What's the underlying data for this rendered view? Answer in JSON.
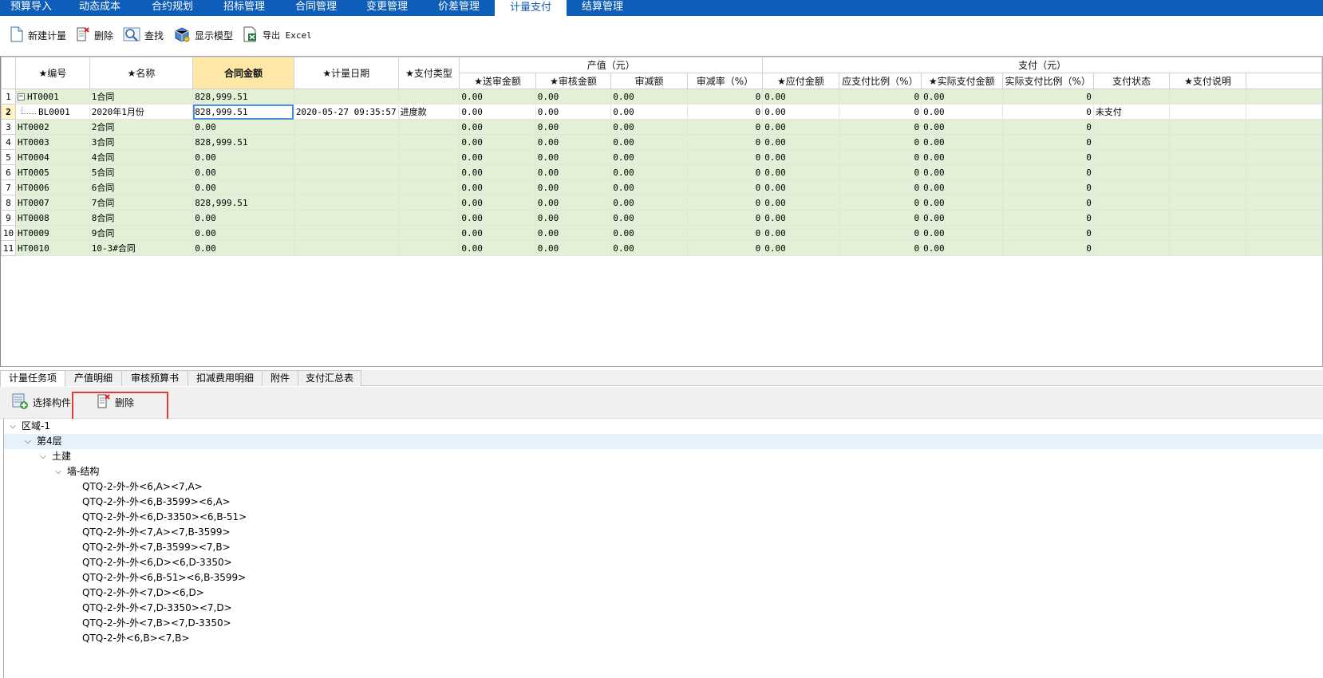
{
  "menu": {
    "items": [
      {
        "label": "预算导入",
        "width": 78
      },
      {
        "label": "动态成本",
        "width": 94
      },
      {
        "label": "合约规划",
        "width": 88
      },
      {
        "label": "招标管理",
        "width": 92
      },
      {
        "label": "合同管理",
        "width": 88
      },
      {
        "label": "变更管理",
        "width": 90
      },
      {
        "label": "价差管理",
        "width": 90
      },
      {
        "label": "计量支付",
        "width": 90,
        "active": true
      },
      {
        "label": "结算管理",
        "width": 90
      }
    ]
  },
  "toolbar": {
    "new": "新建计量",
    "delete": "删除",
    "find": "查找",
    "show_model": "显示模型",
    "export": "导出 Excel"
  },
  "grid": {
    "headers": {
      "code": "★编号",
      "name": "★名称",
      "amount": "合同金额",
      "date": "★计量日期",
      "pay_type": "★支付类型",
      "output_group": "产值（元）",
      "pay_group": "支付（元）",
      "submit_amount": "★送审金额",
      "audit_amount": "★审核金额",
      "reduce_amount": "审减额",
      "reduce_rate": "审减率（%）",
      "payable": "★应付金额",
      "payable_ratio": "应支付比例（%）",
      "actual_pay": "★实际支付金额",
      "actual_ratio": "实际支付比例（%）",
      "pay_status": "支付状态",
      "pay_note": "★支付说明"
    },
    "rows": [
      {
        "no": "1",
        "code": "HT0001",
        "name": "1合同",
        "amount": "828,999.51",
        "date": "",
        "pay_type": "",
        "c1": "0.00",
        "c2": "0.00",
        "c3": "0.00",
        "c4": "0",
        "c5": "0.00",
        "c6": "0",
        "c7": "0.00",
        "c8": "0",
        "c9": "",
        "c10": "",
        "expander": "−"
      },
      {
        "no": "2",
        "code": "BL0001",
        "name": "2020年1月份",
        "amount": "828,999.51",
        "date": "2020-05-27 09:35:57",
        "pay_type": "进度款",
        "c1": "0.00",
        "c2": "0.00",
        "c3": "0.00",
        "c4": "0",
        "c5": "0.00",
        "c6": "0",
        "c7": "0.00",
        "c8": "0",
        "c9": "未支付",
        "c10": "",
        "child": true
      },
      {
        "no": "3",
        "code": "HT0002",
        "name": "2合同",
        "amount": "0.00",
        "date": "",
        "pay_type": "",
        "c1": "0.00",
        "c2": "0.00",
        "c3": "0.00",
        "c4": "0",
        "c5": "0.00",
        "c6": "0",
        "c7": "0.00",
        "c8": "0",
        "c9": "",
        "c10": ""
      },
      {
        "no": "4",
        "code": "HT0003",
        "name": "3合同",
        "amount": "828,999.51",
        "date": "",
        "pay_type": "",
        "c1": "0.00",
        "c2": "0.00",
        "c3": "0.00",
        "c4": "0",
        "c5": "0.00",
        "c6": "0",
        "c7": "0.00",
        "c8": "0",
        "c9": "",
        "c10": ""
      },
      {
        "no": "5",
        "code": "HT0004",
        "name": "4合同",
        "amount": "0.00",
        "date": "",
        "pay_type": "",
        "c1": "0.00",
        "c2": "0.00",
        "c3": "0.00",
        "c4": "0",
        "c5": "0.00",
        "c6": "0",
        "c7": "0.00",
        "c8": "0",
        "c9": "",
        "c10": ""
      },
      {
        "no": "6",
        "code": "HT0005",
        "name": "5合同",
        "amount": "0.00",
        "date": "",
        "pay_type": "",
        "c1": "0.00",
        "c2": "0.00",
        "c3": "0.00",
        "c4": "0",
        "c5": "0.00",
        "c6": "0",
        "c7": "0.00",
        "c8": "0",
        "c9": "",
        "c10": ""
      },
      {
        "no": "7",
        "code": "HT0006",
        "name": "6合同",
        "amount": "0.00",
        "date": "",
        "pay_type": "",
        "c1": "0.00",
        "c2": "0.00",
        "c3": "0.00",
        "c4": "0",
        "c5": "0.00",
        "c6": "0",
        "c7": "0.00",
        "c8": "0",
        "c9": "",
        "c10": ""
      },
      {
        "no": "8",
        "code": "HT0007",
        "name": "7合同",
        "amount": "828,999.51",
        "date": "",
        "pay_type": "",
        "c1": "0.00",
        "c2": "0.00",
        "c3": "0.00",
        "c4": "0",
        "c5": "0.00",
        "c6": "0",
        "c7": "0.00",
        "c8": "0",
        "c9": "",
        "c10": ""
      },
      {
        "no": "9",
        "code": "HT0008",
        "name": "8合同",
        "amount": "0.00",
        "date": "",
        "pay_type": "",
        "c1": "0.00",
        "c2": "0.00",
        "c3": "0.00",
        "c4": "0",
        "c5": "0.00",
        "c6": "0",
        "c7": "0.00",
        "c8": "0",
        "c9": "",
        "c10": ""
      },
      {
        "no": "10",
        "code": "HT0009",
        "name": "9合同",
        "amount": "0.00",
        "date": "",
        "pay_type": "",
        "c1": "0.00",
        "c2": "0.00",
        "c3": "0.00",
        "c4": "0",
        "c5": "0.00",
        "c6": "0",
        "c7": "0.00",
        "c8": "0",
        "c9": "",
        "c10": ""
      },
      {
        "no": "11",
        "code": "HT0010",
        "name": "10-3#合同",
        "amount": "0.00",
        "date": "",
        "pay_type": "",
        "c1": "0.00",
        "c2": "0.00",
        "c3": "0.00",
        "c4": "0",
        "c5": "0.00",
        "c6": "0",
        "c7": "0.00",
        "c8": "0",
        "c9": "",
        "c10": ""
      }
    ]
  },
  "bottom_tabs": [
    {
      "label": "计量任务项",
      "active": true
    },
    {
      "label": "产值明细"
    },
    {
      "label": "审核预算书"
    },
    {
      "label": "扣减费用明细"
    },
    {
      "label": "附件"
    },
    {
      "label": "支付汇总表"
    }
  ],
  "bottom_toolbar": {
    "select": "选择构件",
    "delete": "删除"
  },
  "tree": {
    "nodes": [
      {
        "label": "区域-1",
        "level": 0,
        "expanded": true
      },
      {
        "label": "第4层",
        "level": 1,
        "expanded": true,
        "selected": true
      },
      {
        "label": "土建",
        "level": 2,
        "expanded": true
      },
      {
        "label": "墙-结构",
        "level": 3,
        "expanded": true
      },
      {
        "label": "QTQ-2-外-外<6,A><7,A>",
        "level": 4
      },
      {
        "label": "QTQ-2-外-外<6,B-3599><6,A>",
        "level": 4
      },
      {
        "label": "QTQ-2-外-外<6,D-3350><6,B-51>",
        "level": 4
      },
      {
        "label": "QTQ-2-外-外<7,A><7,B-3599>",
        "level": 4
      },
      {
        "label": "QTQ-2-外-外<7,B-3599><7,B>",
        "level": 4
      },
      {
        "label": "QTQ-2-外-外<6,D><6,D-3350>",
        "level": 4
      },
      {
        "label": "QTQ-2-外-外<6,B-51><6,B-3599>",
        "level": 4
      },
      {
        "label": "QTQ-2-外-外<7,D><6,D>",
        "level": 4
      },
      {
        "label": "QTQ-2-外-外<7,D-3350><7,D>",
        "level": 4
      },
      {
        "label": "QTQ-2-外-外<7,B><7,D-3350>",
        "level": 4
      },
      {
        "label": "QTQ-2-外<6,B><7,B>",
        "level": 4
      }
    ]
  }
}
